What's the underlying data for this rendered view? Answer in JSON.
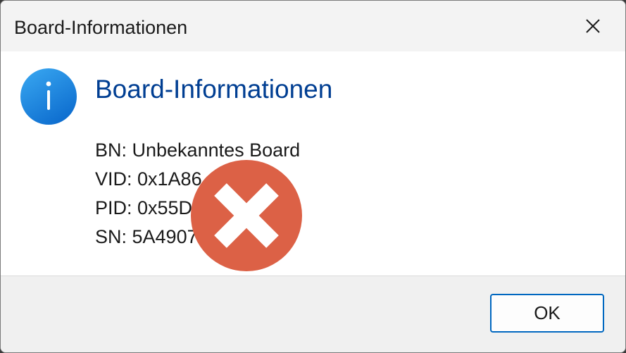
{
  "window": {
    "title": "Board-Informationen",
    "close_icon": "close-icon"
  },
  "message": {
    "icon": "info-icon",
    "heading": "Board-Informationen",
    "lines": [
      "BN: Unbekanntes Board",
      "VID: 0x1A86",
      "PID: 0x55D",
      "SN: 5A4907"
    ]
  },
  "overlay": {
    "icon": "error-x-icon",
    "color": "#dc6146"
  },
  "buttons": {
    "ok_label": "OK"
  },
  "colors": {
    "heading": "#003e92",
    "accent": "#0067c0",
    "info_icon": "#1b8ee3"
  }
}
